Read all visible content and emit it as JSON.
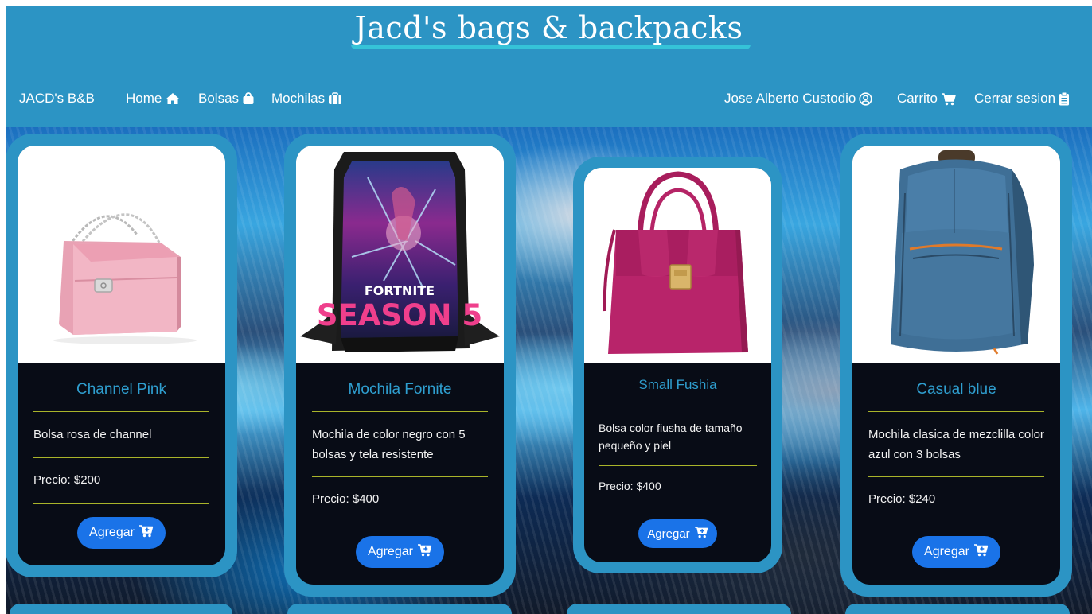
{
  "header": {
    "site_title": "Jacd's bags & backpacks",
    "brand": "JACD's B&B",
    "nav": {
      "home": "Home",
      "bolsas": "Bolsas",
      "mochilas": "Mochilas",
      "user": "Jose Alberto Custodio",
      "cart": "Carrito",
      "logout": "Cerrar sesion"
    }
  },
  "colors": {
    "header_bg": "#2c94c4",
    "card_border": "#2c94c4",
    "title_accent": "#2f9fd0",
    "divider": "#a9b42a",
    "button": "#1a73e8"
  },
  "icons": {
    "home": "home-icon",
    "bolsas": "shopping-bag-icon",
    "mochilas": "suitcase-icon",
    "user": "user-circle-icon",
    "cart": "cart-icon",
    "logout": "clipboard-icon",
    "add": "cart-plus-icon"
  },
  "products": [
    {
      "title": "Channel Pink",
      "description": "Bolsa rosa de channel",
      "price": "Precio: $200",
      "button": "Agregar",
      "image": "pink bag"
    },
    {
      "title": "Mochila Fornite",
      "description": "Mochila de color negro con 5 bolsas y tela resistente",
      "price": "Precio: $400",
      "button": "Agregar",
      "image": "backpack"
    },
    {
      "title": "Small Fushia",
      "description": "Bolsa color fiusha de tamaño pequeño y piel",
      "price": "Precio: $400",
      "button": "Agregar",
      "image": "fuchsia bag"
    },
    {
      "title": "Casual blue",
      "description": "Mochila clasica de mezclilla color azul con 3 bolsas",
      "price": "Precio: $240",
      "button": "Agregar",
      "image": "blue backpack"
    }
  ],
  "backpack_print": {
    "line1": "FORTNITE",
    "line2": "SEASON 5"
  }
}
